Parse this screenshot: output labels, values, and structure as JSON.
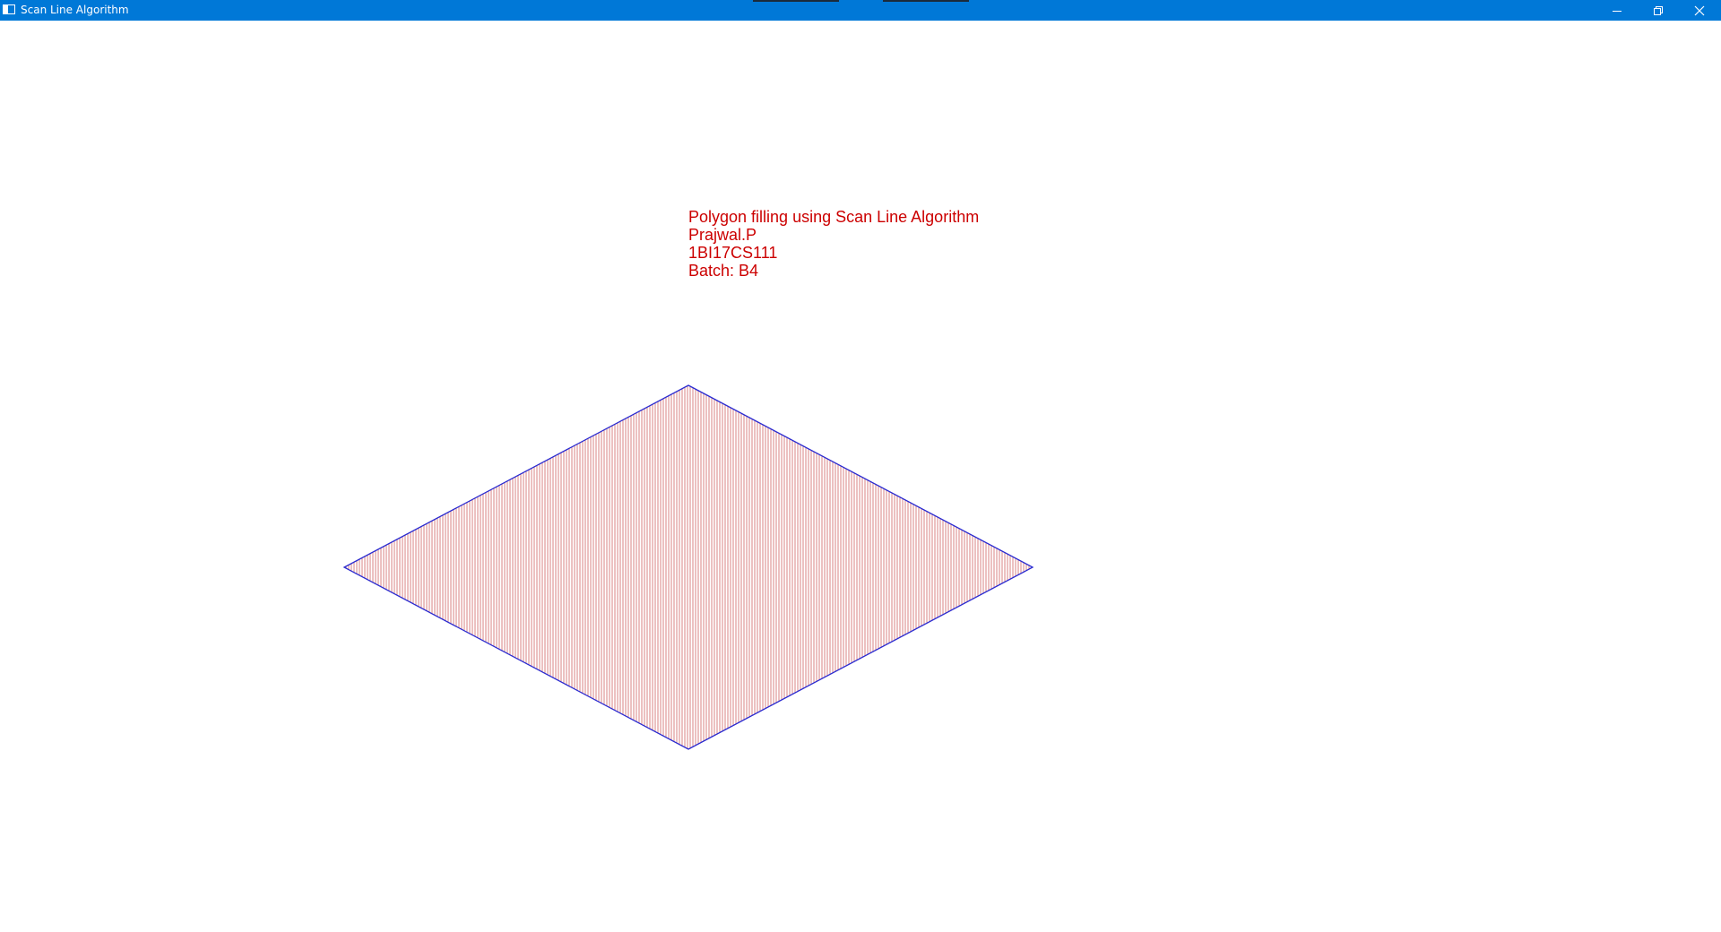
{
  "window": {
    "title": "Scan Line Algorithm",
    "titlebar_color": "#0078d7"
  },
  "caption_buttons": {
    "minimize_icon": "minimize-icon",
    "restore_icon": "restore-icon",
    "close_icon": "close-icon"
  },
  "info": {
    "heading": "Polygon filling using Scan Line Algorithm",
    "name": "Prajwal.P",
    "usn": "1BI17CS111",
    "batch": "Batch: B4",
    "text_color": "#cc0000"
  },
  "polygon": {
    "outline_color": "#2a2ad0",
    "fill_color": "#c03030"
  }
}
